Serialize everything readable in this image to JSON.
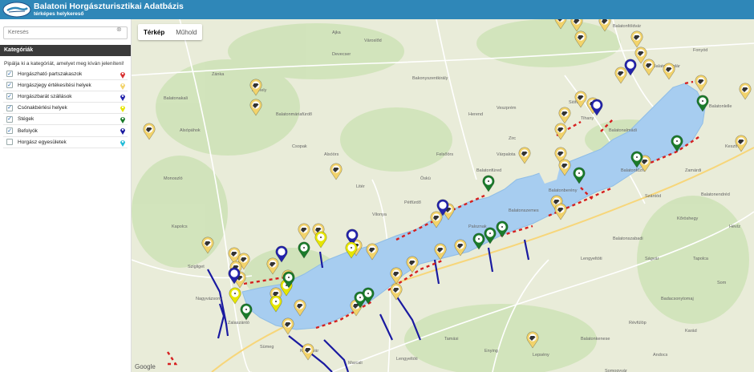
{
  "header": {
    "title": "Balatoni Horgászturisztikai Adatbázis",
    "subtitle": "térképes helykereső"
  },
  "search": {
    "placeholder": "Keresés",
    "value": ""
  },
  "categories": {
    "heading": "Kategóriák",
    "hint": "Pipálja ki a kategóriát, amelyet meg kíván jeleníteni!",
    "items": [
      {
        "label": "Horgászható partszakaszok",
        "checked": true,
        "color": "#d83030"
      },
      {
        "label": "Horgászjegy értékesítési helyek",
        "checked": true,
        "color": "#f2d36b"
      },
      {
        "label": "Horgászbarát szállások",
        "checked": true,
        "color": "#2222aa"
      },
      {
        "label": "Csónakbérlési helyek",
        "checked": true,
        "color": "#e6e600"
      },
      {
        "label": "Stégek",
        "checked": true,
        "color": "#1a7a2a"
      },
      {
        "label": "Befolyók",
        "checked": true,
        "color": "#1a1aa0"
      },
      {
        "label": "Horgász egyesületek",
        "checked": false,
        "color": "#22bcd8"
      }
    ]
  },
  "map": {
    "tabs": [
      {
        "label": "Térkép",
        "active": true
      },
      {
        "label": "Műhold",
        "active": false
      }
    ],
    "attribution": "Google",
    "place_labels": [
      "Ajka",
      "Városlőd",
      "Devecser",
      "Bakonyszentkirály",
      "Veszprém",
      "Herend",
      "Zirc",
      "Várpalota",
      "Balatonfüred",
      "Tihany",
      "Siófok",
      "Balatonalmádi",
      "Balatonfűzfő",
      "Szántód",
      "Zamárdi",
      "Balatonföldvár",
      "Balatonboglár",
      "Fonyód",
      "Balatonlelle",
      "Keszthely",
      "Hévíz",
      "Tapolca",
      "Badacsonytomaj",
      "Révfülöp",
      "Balatonkenese",
      "Lepsény",
      "Enying",
      "Tamási",
      "Lengyeltóti",
      "Marcali",
      "Kaposvár",
      "Sümeg",
      "Zalaszántó",
      "Nagyvázsony",
      "Szigliget",
      "Kapolcs",
      "Monoszló",
      "Alsópáhok",
      "Balatonakali",
      "Zánka",
      "Kéthely",
      "Balatonmáriafürdő",
      "Csopak",
      "Alsóörs",
      "Litér",
      "Vilonya",
      "Pétfürdő",
      "Öskü",
      "Felsőörs",
      "Paloznak",
      "Balatonszemes",
      "Balatonberény",
      "Lengyeltóti",
      "Balatonszabadi",
      "Ságvár",
      "Kőröshegy",
      "Balatonendréd",
      "Som",
      "Karád",
      "Andocs",
      "Somogyvár"
    ]
  }
}
